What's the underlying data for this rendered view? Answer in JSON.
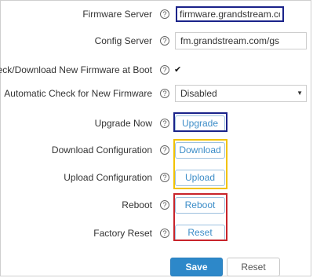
{
  "form": {
    "firmware_server": {
      "label": "Firmware Server",
      "value": "firmware.grandstream.com"
    },
    "config_server": {
      "label": "Config Server",
      "value": "fm.grandstream.com/gs"
    },
    "check_at_boot": {
      "label": "Check/Download New Firmware at Boot",
      "checked": true,
      "check_glyph": "✔"
    },
    "auto_check": {
      "label": "Automatic Check for New Firmware",
      "selected": "Disabled"
    },
    "upgrade_now": {
      "label": "Upgrade Now",
      "button": "Upgrade"
    },
    "download_config": {
      "label": "Download Configuration",
      "button": "Download"
    },
    "upload_config": {
      "label": "Upload Configuration",
      "button": "Upload"
    },
    "reboot": {
      "label": "Reboot",
      "button": "Reboot"
    },
    "factory_reset": {
      "label": "Factory Reset",
      "button": "Reset"
    }
  },
  "help_glyph": "?",
  "footer": {
    "save_label": "Save",
    "reset_label": "Reset"
  },
  "colors": {
    "save_button": "#2d88c9",
    "action_text": "#3c8dc8",
    "highlight_blue": "#1a238a",
    "highlight_yellow": "#f2c200",
    "highlight_red": "#c8242b"
  },
  "icons": {
    "help": "help-circle-icon",
    "dropdown": "chevron-down-icon",
    "checkbox": "checkbox-checked-icon"
  }
}
